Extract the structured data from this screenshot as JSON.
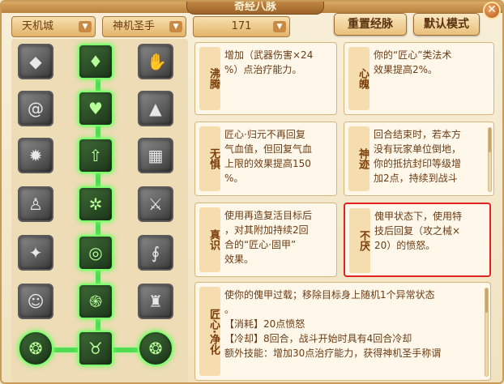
{
  "window": {
    "title": "奇经八脉",
    "close_label": "✕"
  },
  "filters": {
    "sect": "天机城",
    "school": "神机圣手",
    "level": "171"
  },
  "buttons": {
    "reset": "重置经脉",
    "default_mode": "默认模式"
  },
  "talents": [
    {
      "name": "沸腾",
      "desc": [
        "增加（武器伤害×24",
        "%）点治疗能力。"
      ],
      "selected": false
    },
    {
      "name": "心魄",
      "desc": [
        "你的“匠心”类法术",
        "效果提高2%。"
      ],
      "selected": false
    },
    {
      "name": "无惧",
      "desc": [
        "匠心·归元不再回复",
        "气血值，但回复气血",
        "上限的效果提高150",
        "%。"
      ],
      "selected": false
    },
    {
      "name": "神迹",
      "desc": [
        "回合结束时，若本方",
        "没有玩家单位倒地，",
        "你的抵抗封印等级增",
        "加2点，持续到战斗"
      ],
      "selected": false
    },
    {
      "name": "真识",
      "desc": [
        "使用再造复活目标后",
        "，对其附加持续2回",
        "合的“匠心·固甲”",
        "效果。"
      ],
      "selected": false
    },
    {
      "name": "不厌",
      "desc": [
        "傀甲状态下，使用特",
        "技后回复（攻之械×",
        "20）的愤怒。"
      ],
      "selected": true
    },
    {
      "name": "匠心·净化",
      "desc": [
        "使你的傀甲过载；移除目标身上随机1个异常状态",
        "。",
        "【消耗】20点愤怒",
        "【冷却】8回合，战斗开始时具有4回合冷却",
        "额外技能：增加30点治疗能力，获得神机圣手称谓"
      ],
      "selected": false
    }
  ],
  "nodes": [
    {
      "icon": "diamond-icon",
      "active": false
    },
    {
      "icon": "blade-icon",
      "active": true
    },
    {
      "icon": "hand-icon",
      "active": false
    },
    {
      "icon": "spiral-icon",
      "active": false
    },
    {
      "icon": "heart-icon",
      "active": true
    },
    {
      "icon": "bell-icon",
      "active": false
    },
    {
      "icon": "sun-icon",
      "active": false
    },
    {
      "icon": "arrow-up-icon",
      "active": true
    },
    {
      "icon": "wall-icon",
      "active": false
    },
    {
      "icon": "figure-icon",
      "active": false
    },
    {
      "icon": "gear-icon",
      "active": true
    },
    {
      "icon": "swords-icon",
      "active": false
    },
    {
      "icon": "star-icon",
      "active": false
    },
    {
      "icon": "target-icon",
      "active": true
    },
    {
      "icon": "snake-icon",
      "active": false
    },
    {
      "icon": "beast-icon",
      "active": false
    },
    {
      "icon": "vortex-icon",
      "active": true
    },
    {
      "icon": "warrior-icon",
      "active": false
    },
    {
      "icon": "dragon-left-icon",
      "active": true
    },
    {
      "icon": "dragon-center-icon",
      "active": true
    },
    {
      "icon": "dragon-right-icon",
      "active": true
    }
  ],
  "colors": {
    "active_glow": "#6dff5a",
    "selected_border": "#e02323",
    "text_brown": "#6b3b13"
  }
}
